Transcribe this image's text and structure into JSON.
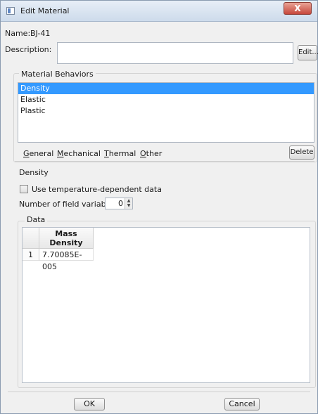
{
  "window": {
    "title": "Edit Material",
    "close_label": "X"
  },
  "name": {
    "label": "Name:",
    "value": "BJ-41"
  },
  "description": {
    "label": "Description:",
    "edit_button": "Edit..."
  },
  "behaviors": {
    "group_label": "Material Behaviors",
    "items": [
      "Density",
      "Elastic",
      "Plastic"
    ],
    "selected": "Density"
  },
  "menubar": {
    "items": [
      "General",
      "Mechanical",
      "Thermal",
      "Other"
    ],
    "delete_button": "Delete"
  },
  "density_section": {
    "title": "Density",
    "temp_dependent_label": "Use temperature-dependent data",
    "temp_dependent_checked": false,
    "field_vars_label": "Number of field variables:",
    "field_vars_value": "0",
    "data_label": "Data",
    "table": {
      "header_line1": "Mass",
      "header_line2": "Density",
      "rows": [
        {
          "index": "1",
          "mass_density": "7.70085E-005"
        }
      ]
    }
  },
  "footer": {
    "ok_button": "OK",
    "cancel_button": "Cancel"
  }
}
